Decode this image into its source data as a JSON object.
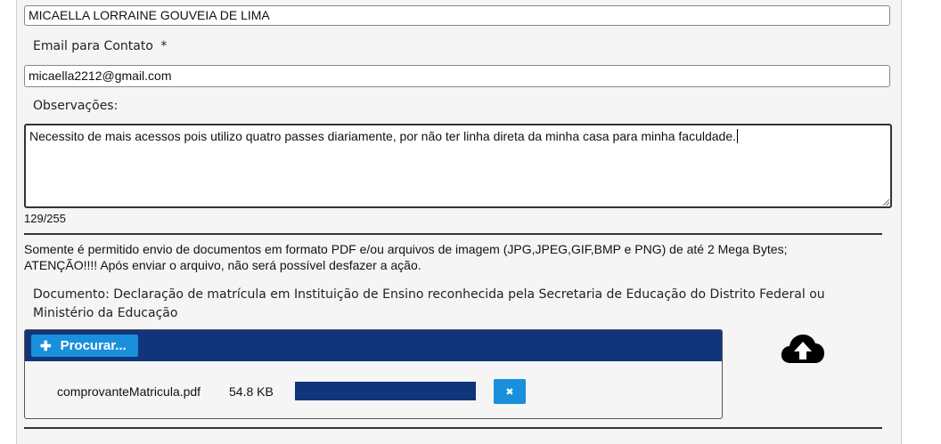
{
  "form": {
    "name_value": "MICAELLA LORRAINE GOUVEIA DE LIMA",
    "email_label": "Email para Contato",
    "email_required": "*",
    "email_value": "micaella2212@gmail.com",
    "obs_label": "Observações:",
    "obs_value": "Necessito de mais acessos pois utilizo quatro passes diariamente, por não ter linha direta da minha casa para minha faculdade.",
    "obs_counter": "129/255"
  },
  "upload_info": {
    "line1": "Somente é permitido envio de documentos em formato PDF e/ou arquivos de imagem (JPG,JPEG,GIF,BMP e PNG) de até 2 Mega Bytes;",
    "line2": "ATENÇÃO!!!! Após enviar o arquivo, não será possível desfazer a ação."
  },
  "document": {
    "label": "Documento: Declaração de matrícula em Instituição de Ensino reconhecida pela Secretaria de Educação do Distrito Federal ou Ministério da Educação",
    "browse_label": "Procurar...",
    "browse_icon": "plus-icon",
    "file": {
      "name": "comprovanteMatricula.pdf",
      "size": "54.8 KB",
      "progress": 1.0,
      "remove_icon": "close-icon"
    },
    "upload_icon": "cloud-upload-icon"
  },
  "colors": {
    "header_bar": "#12347a",
    "button": "#1a8fdc",
    "progress": "#12347a"
  }
}
